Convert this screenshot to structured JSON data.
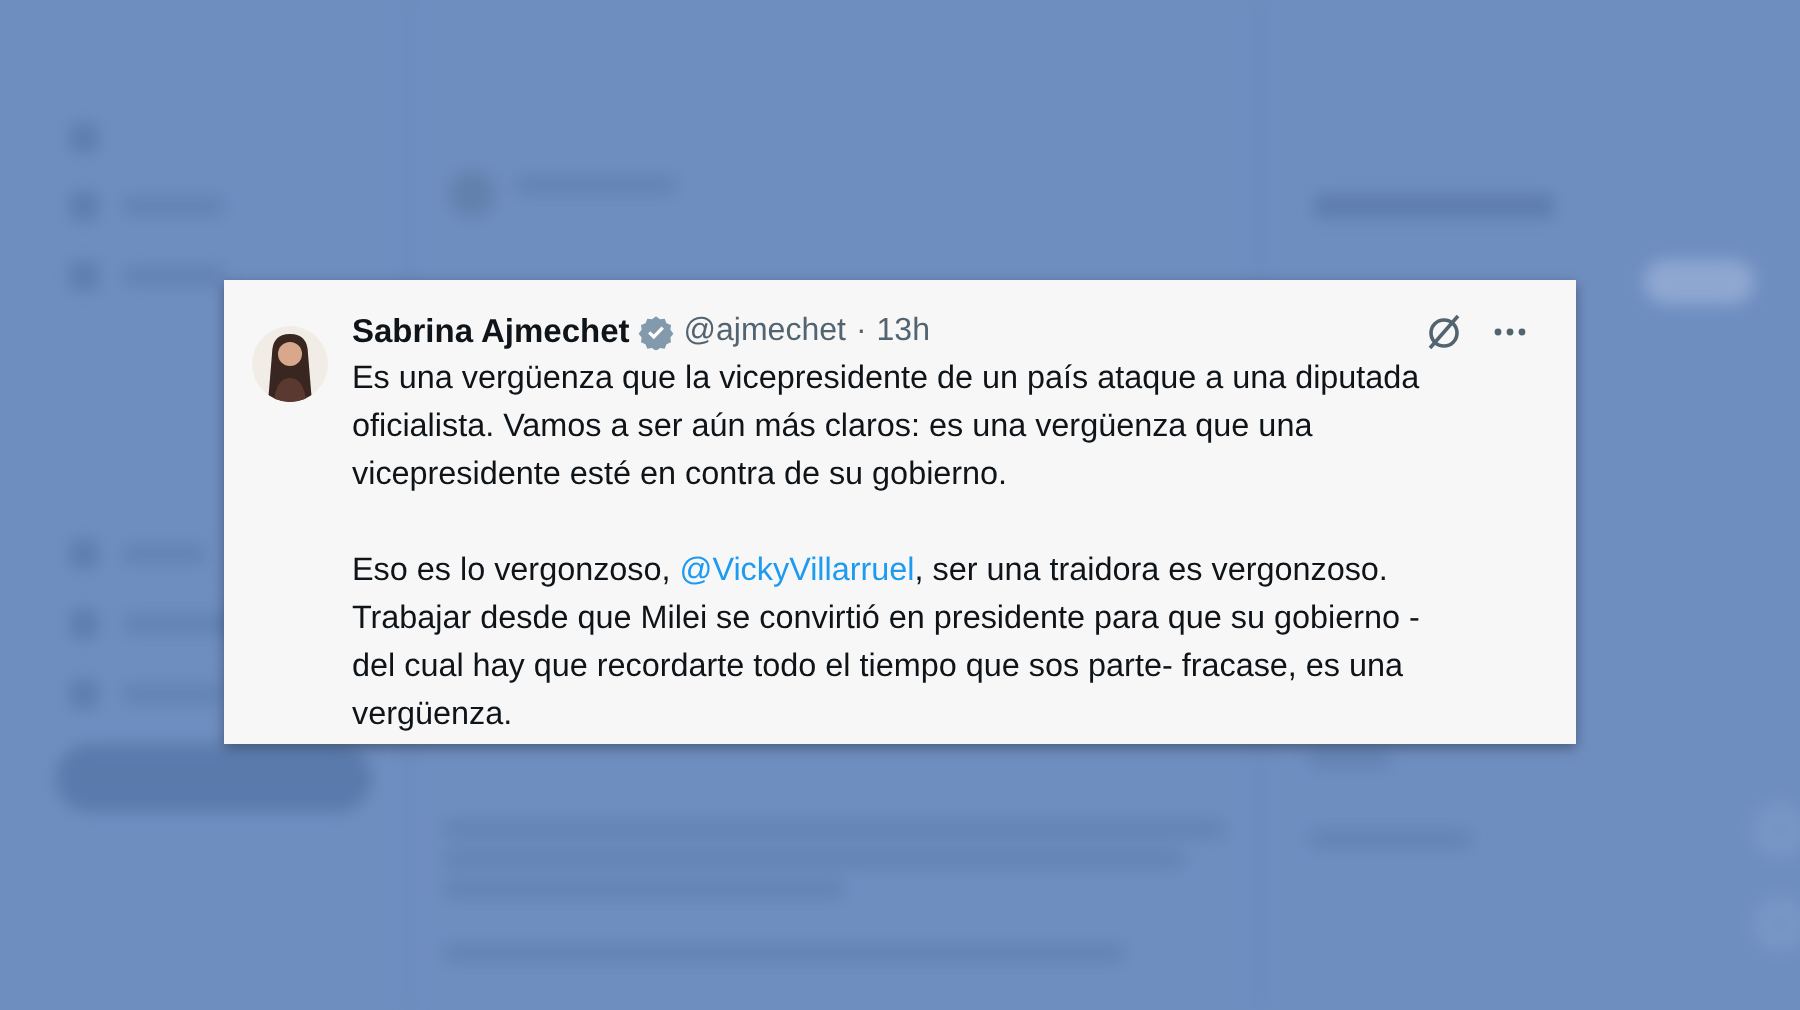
{
  "tweet": {
    "author": "Sabrina Ajmechet",
    "verified": true,
    "handle": "@ajmechet",
    "separator": "·",
    "time": "13h",
    "paragraphs": [
      {
        "lines": [
          [
            {
              "text": "Es una vergüenza que la vicepresidente de un país ataque a una diputada"
            }
          ],
          [
            {
              "text": "oficialista. Vamos a ser aún más claros: es una vergüenza que una"
            }
          ],
          [
            {
              "text": "vicepresidente esté en contra de su gobierno."
            }
          ]
        ]
      },
      {
        "lines": [
          [
            {
              "text": "Eso es lo vergonzoso, "
            },
            {
              "kind": "mention",
              "text": "@VickyVillarruel"
            },
            {
              "text": ", ser una traidora es vergonzoso."
            }
          ],
          [
            {
              "text": "Trabajar desde que Milei se convirtió en presidente para que su gobierno -"
            }
          ],
          [
            {
              "text": "del cual hay que recordarte todo el tiempo que sos parte- fracase, es una"
            }
          ],
          [
            {
              "text": "vergüenza."
            }
          ]
        ]
      }
    ]
  }
}
